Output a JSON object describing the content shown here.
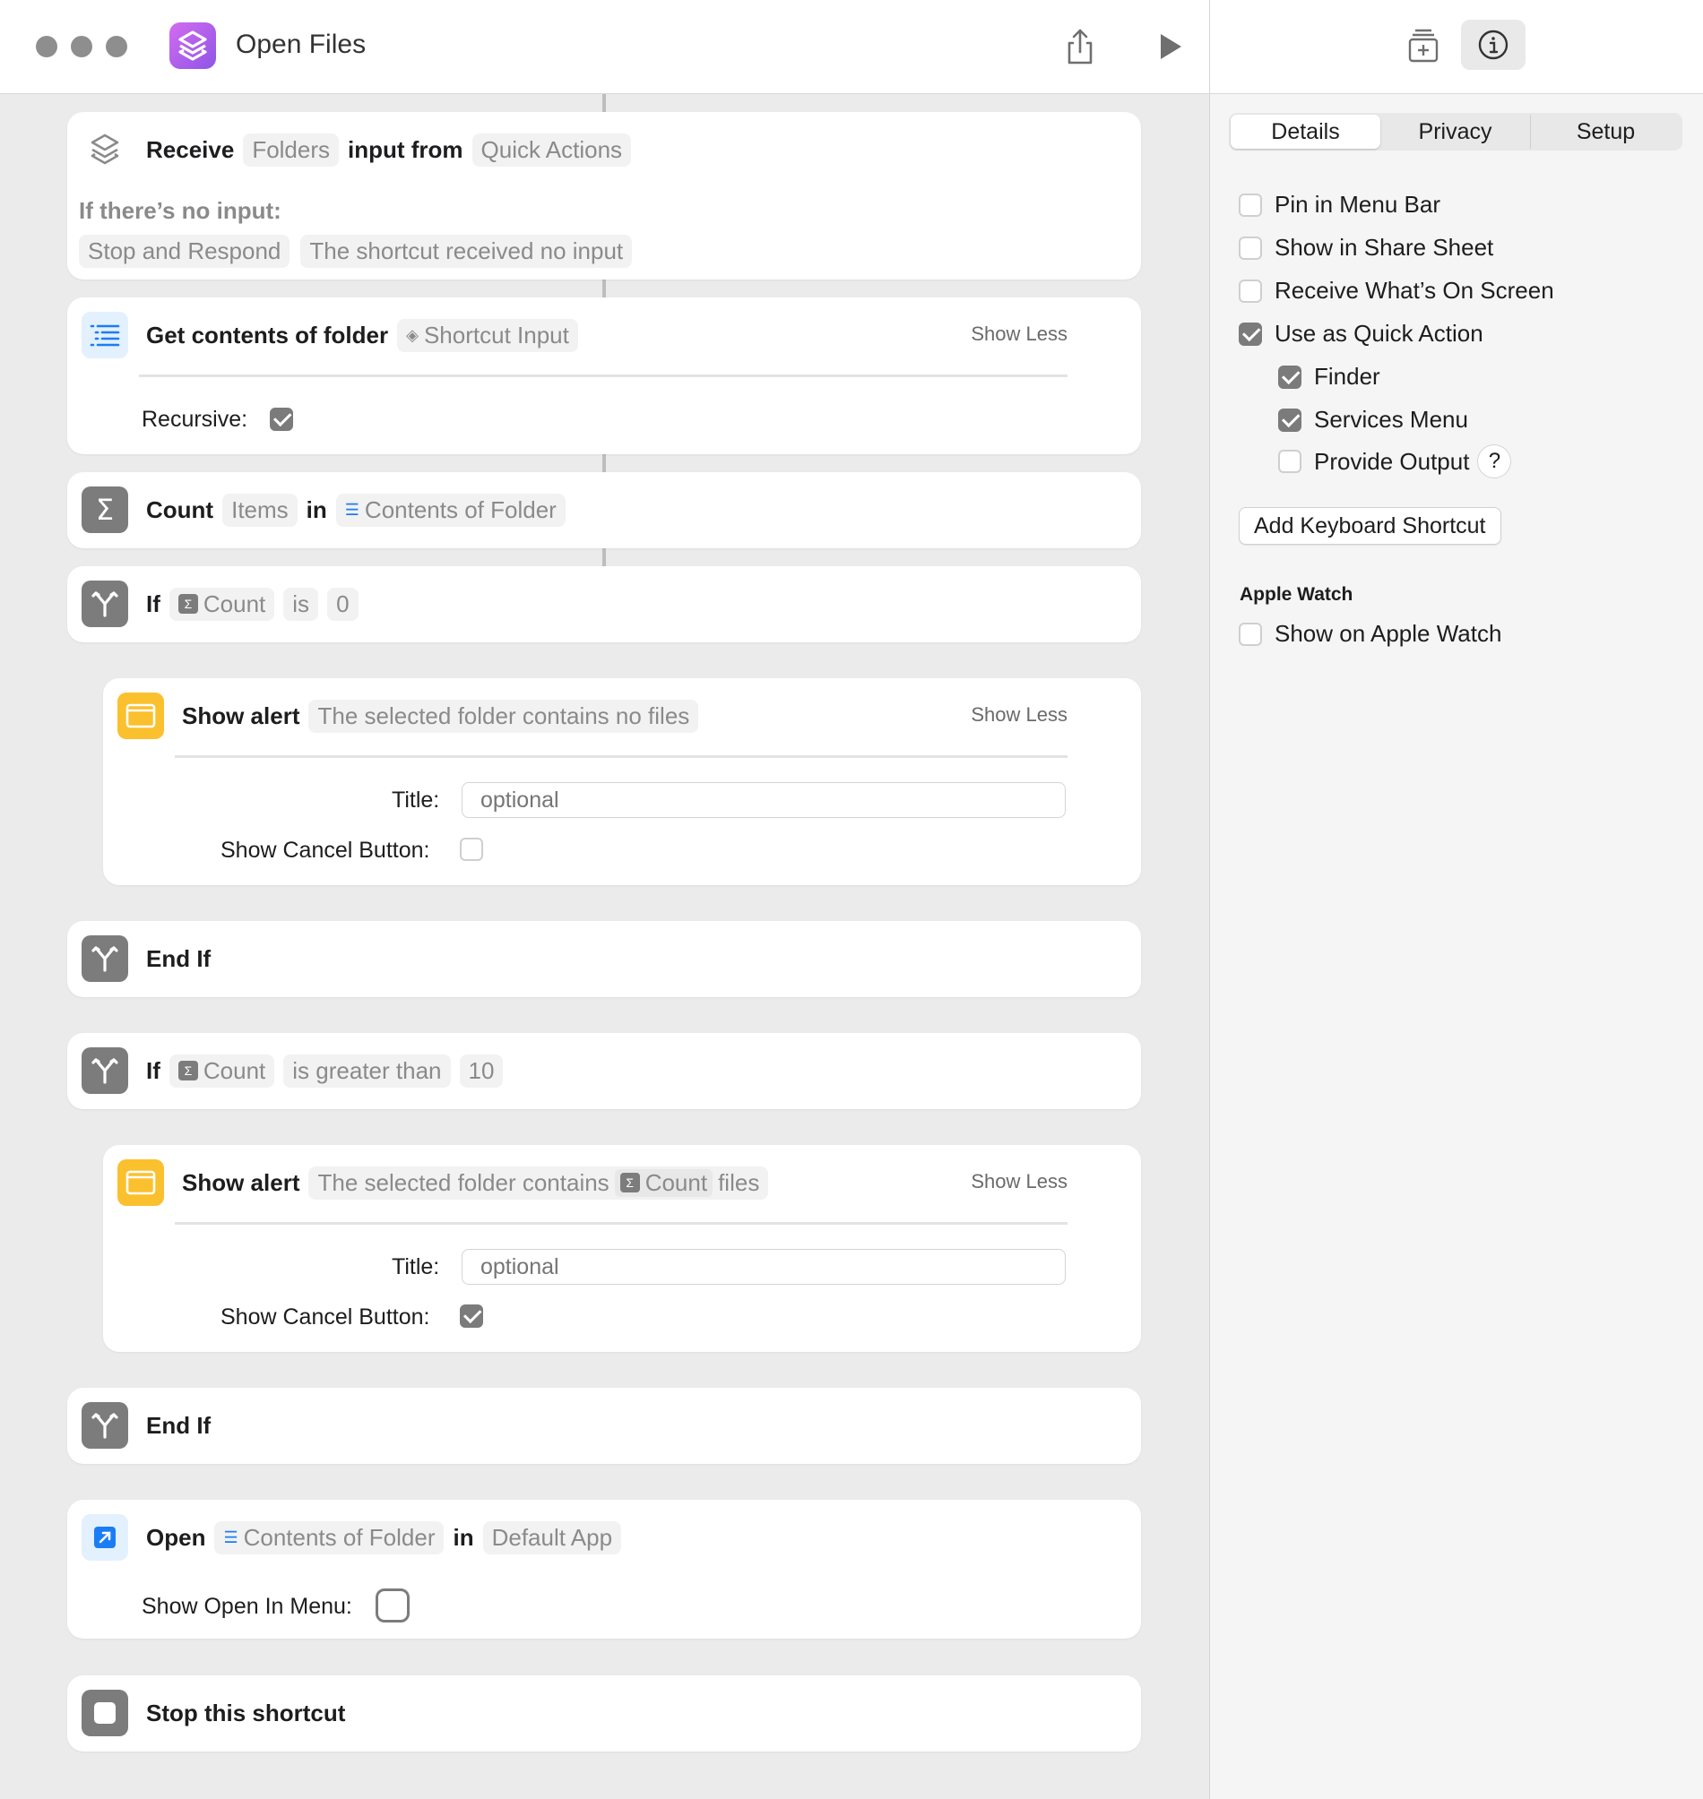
{
  "window": {
    "title": "Open Files"
  },
  "actions": {
    "receive": {
      "verb": "Receive",
      "input_type": "Folders",
      "middle": "input from",
      "source": "Quick Actions",
      "no_input_label": "If there’s no input:",
      "no_input_action": "Stop and Respond",
      "no_input_message": "The shortcut received no input"
    },
    "get_contents": {
      "verb": "Get contents of folder",
      "variable": "Shortcut Input",
      "show_less": "Show Less",
      "recursive_label": "Recursive:",
      "recursive": true
    },
    "count": {
      "verb": "Count",
      "what": "Items",
      "middle": "in",
      "variable": "Contents of Folder"
    },
    "if1": {
      "verb": "If",
      "variable": "Count",
      "condition": "is",
      "value": "0"
    },
    "alert1": {
      "verb": "Show alert",
      "message": "The selected folder contains no files",
      "show_less": "Show Less",
      "title_label": "Title:",
      "title_placeholder": "optional",
      "cancel_label": "Show Cancel Button:",
      "cancel": false
    },
    "endif1": {
      "verb": "End If"
    },
    "if2": {
      "verb": "If",
      "variable": "Count",
      "condition": "is greater than",
      "value": "10"
    },
    "alert2": {
      "verb": "Show alert",
      "message_prefix": "The selected folder contains",
      "variable": "Count",
      "message_suffix": "files",
      "show_less": "Show Less",
      "title_label": "Title:",
      "title_placeholder": "optional",
      "cancel_label": "Show Cancel Button:",
      "cancel": true
    },
    "endif2": {
      "verb": "End If"
    },
    "open": {
      "verb": "Open",
      "variable": "Contents of Folder",
      "middle": "in",
      "app": "Default App",
      "menu_label": "Show Open In Menu:",
      "menu": false
    },
    "stop": {
      "verb": "Stop this shortcut"
    }
  },
  "sidebar": {
    "tabs": [
      "Details",
      "Privacy",
      "Setup"
    ],
    "selected_tab": "Details",
    "options": [
      {
        "label": "Pin in Menu Bar",
        "checked": false
      },
      {
        "label": "Show in Share Sheet",
        "checked": false
      },
      {
        "label": "Receive What’s On Screen",
        "checked": false
      },
      {
        "label": "Use as Quick Action",
        "checked": true
      },
      {
        "label": "Finder",
        "checked": true
      },
      {
        "label": "Services Menu",
        "checked": true
      },
      {
        "label": "Provide Output",
        "checked": false
      }
    ],
    "help_glyph": "?",
    "keyboard_button": "Add Keyboard Shortcut",
    "apple_watch_header": "Apple Watch",
    "apple_watch_option": {
      "label": "Show on Apple Watch",
      "checked": false
    }
  },
  "colors": {
    "accent_purple": "#a85ff0",
    "alert_yellow": "#fbc02d",
    "open_blue": "#1a7df5",
    "control_gray": "#7c7c7c"
  }
}
